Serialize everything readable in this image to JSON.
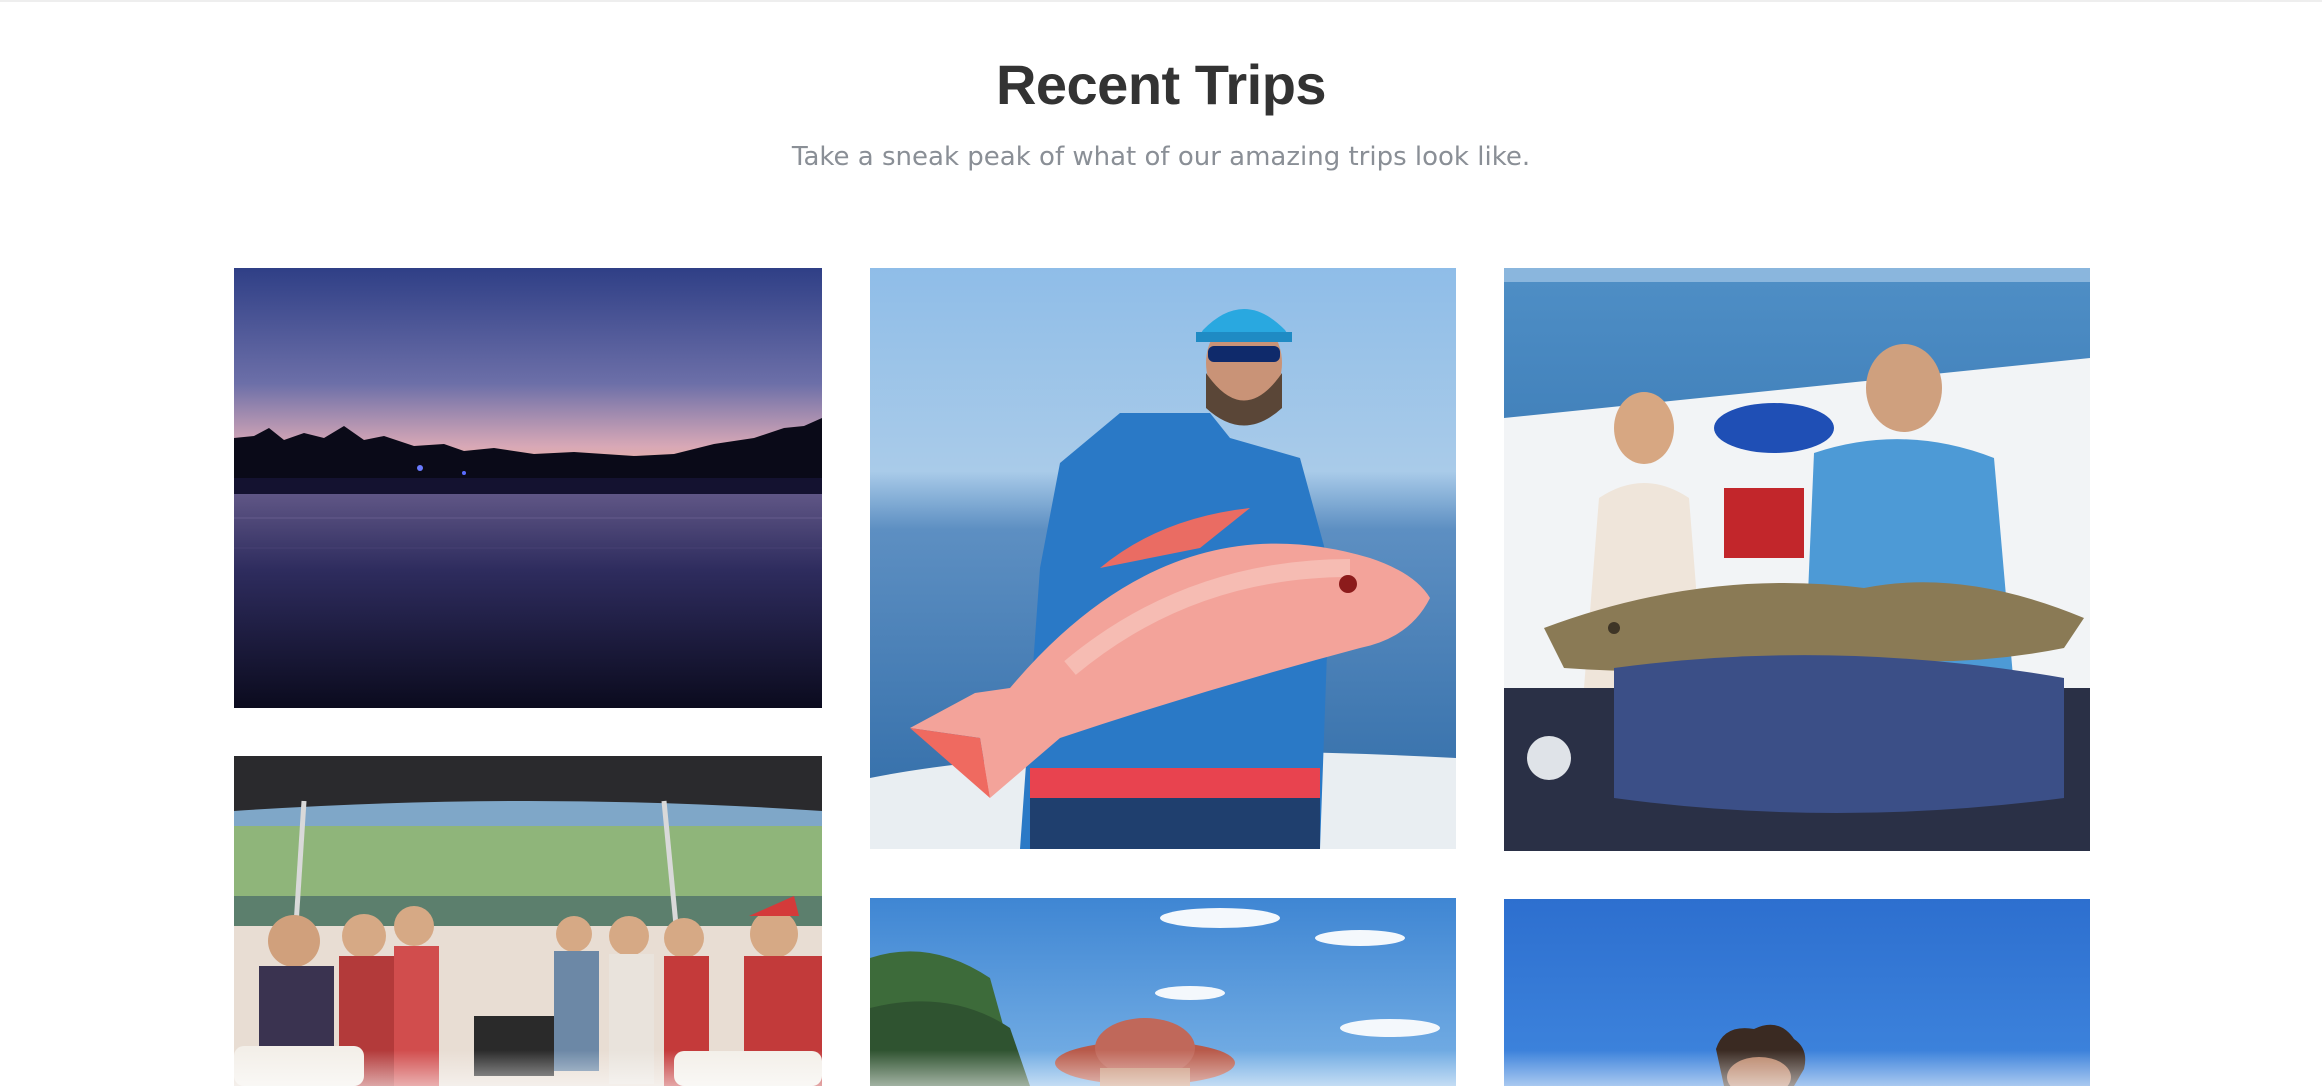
{
  "section": {
    "title": "Recent Trips",
    "subtitle": "Take a sneak peak of what of our amazing trips look like."
  },
  "gallery": {
    "photos": [
      {
        "subject": "sunset over calm river"
      },
      {
        "subject": "fisherman holding red snapper"
      },
      {
        "subject": "couple holding large cod on boat"
      },
      {
        "subject": "party group on pontoon boat"
      },
      {
        "subject": "angler in hat near shoreline"
      },
      {
        "subject": "person on boat under blue sky"
      }
    ]
  }
}
